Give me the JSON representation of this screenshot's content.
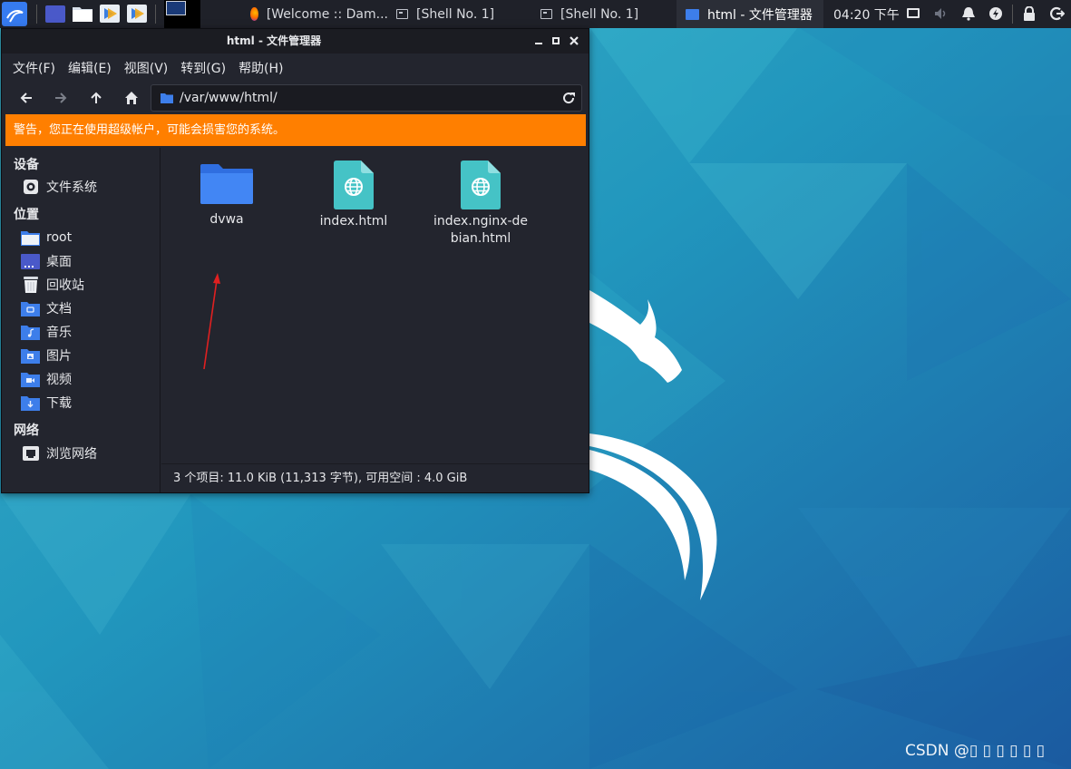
{
  "taskbar": {
    "tasks": [
      {
        "label": "[Welcome :: Dam...",
        "icon": "firefox-icon",
        "active": false
      },
      {
        "label": "[Shell No. 1]",
        "icon": "terminal-icon",
        "active": false
      },
      {
        "label": "[Shell No. 1]",
        "icon": "terminal-icon",
        "active": false
      },
      {
        "label": "html - 文件管理器",
        "icon": "folder-icon",
        "active": true
      }
    ],
    "clock": "04:20 下午"
  },
  "window": {
    "title": "html - 文件管理器",
    "menu": [
      "文件(F)",
      "编辑(E)",
      "视图(V)",
      "转到(G)",
      "帮助(H)"
    ],
    "location": "/var/www/html/",
    "warning": "警告，您正在使用超级帐户，可能会损害您的系统。",
    "sidebar": {
      "devices_heading": "设备",
      "devices": [
        {
          "label": "文件系统",
          "icon": "drive-icon"
        }
      ],
      "places_heading": "位置",
      "places": [
        {
          "label": "root",
          "icon": "home-folder-icon"
        },
        {
          "label": "桌面",
          "icon": "desktop-icon"
        },
        {
          "label": "回收站",
          "icon": "trash-icon"
        },
        {
          "label": "文档",
          "icon": "documents-folder-icon"
        },
        {
          "label": "音乐",
          "icon": "music-folder-icon"
        },
        {
          "label": "图片",
          "icon": "pictures-folder-icon"
        },
        {
          "label": "视频",
          "icon": "videos-folder-icon"
        },
        {
          "label": "下载",
          "icon": "downloads-folder-icon"
        }
      ],
      "network_heading": "网络",
      "network": [
        {
          "label": "浏览网络",
          "icon": "network-icon"
        }
      ]
    },
    "files": [
      {
        "name": "dvwa",
        "type": "folder"
      },
      {
        "name": "index.html",
        "type": "html"
      },
      {
        "name": "index.nginx-debian.html",
        "type": "html"
      }
    ],
    "status": "3 个项目: 11.0 KiB (11,313 字节), 可用空间 : 4.0 GiB"
  },
  "watermark": "CSDN @▯ ▯ ▯ ▯ ▯ ▯",
  "colors": {
    "warning": "#ff7f00",
    "folder_blue": "#3d7eea",
    "html_teal": "#45c3c6",
    "annotation_arrow": "#e02020"
  }
}
